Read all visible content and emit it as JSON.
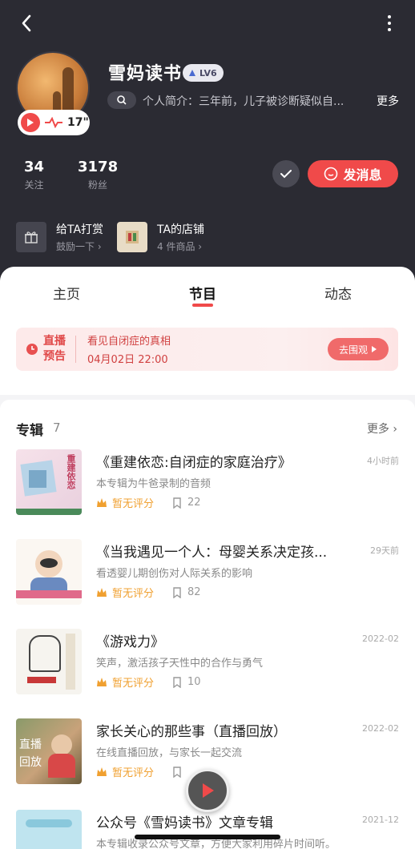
{
  "profile": {
    "name": "雪妈读书",
    "level": "LV6",
    "bio": "个人简介：三年前，儿子被诊断疑似自...",
    "bio_more": "更多",
    "live_duration": "17\"",
    "stats": [
      {
        "value": "34",
        "label": "关注"
      },
      {
        "value": "3178",
        "label": "粉丝"
      }
    ],
    "message_button": "发消息"
  },
  "shortcuts": [
    {
      "title": "给TA打赏",
      "subtitle": "鼓励一下",
      "icon": "gift-icon"
    },
    {
      "title": "TA的店铺",
      "subtitle": "4 件商品",
      "icon": "shop-icon"
    }
  ],
  "tabs": [
    "主页",
    "节目",
    "动态"
  ],
  "active_tab": "节目",
  "live_notice": {
    "tag": "直播预告",
    "title": "看见自闭症的真相",
    "time": "04月02日 22:00",
    "button": "去围观"
  },
  "albums": {
    "heading": "专辑",
    "count": "7",
    "more": "更多",
    "items": [
      {
        "title": "《重建依恋:自闭症的家庭治疗》",
        "desc": "本专辑为牛爸录制的音频",
        "time": "4小时前",
        "rating": "暂无评分",
        "count": "22"
      },
      {
        "title": "《当我遇见一个人：母婴关系决定孩...",
        "desc": "看透婴儿期创伤对人际关系的影响",
        "time": "29天前",
        "rating": "暂无评分",
        "count": "82"
      },
      {
        "title": "《游戏力》",
        "desc": "笑声，激活孩子天性中的合作与勇气",
        "time": "2022-02",
        "rating": "暂无评分",
        "count": "10"
      },
      {
        "title": "家长关心的那些事（直播回放）",
        "desc": "在线直播回放，与家长一起交流",
        "time": "2022-02",
        "rating": "暂无评分",
        "count": ""
      },
      {
        "title": "公众号《雪妈读书》文章专辑",
        "desc": "本专辑收录公众号文章，方便大家利用碎片时间听。",
        "time": "2021-12",
        "rating": "",
        "count": ""
      }
    ]
  },
  "covers": {
    "cover1_text": "重建依恋",
    "cover4_text": "直播回放"
  },
  "colors": {
    "accent": "#f04a4a",
    "header_bg": "#2b2b33",
    "rating": "#f0a030"
  }
}
